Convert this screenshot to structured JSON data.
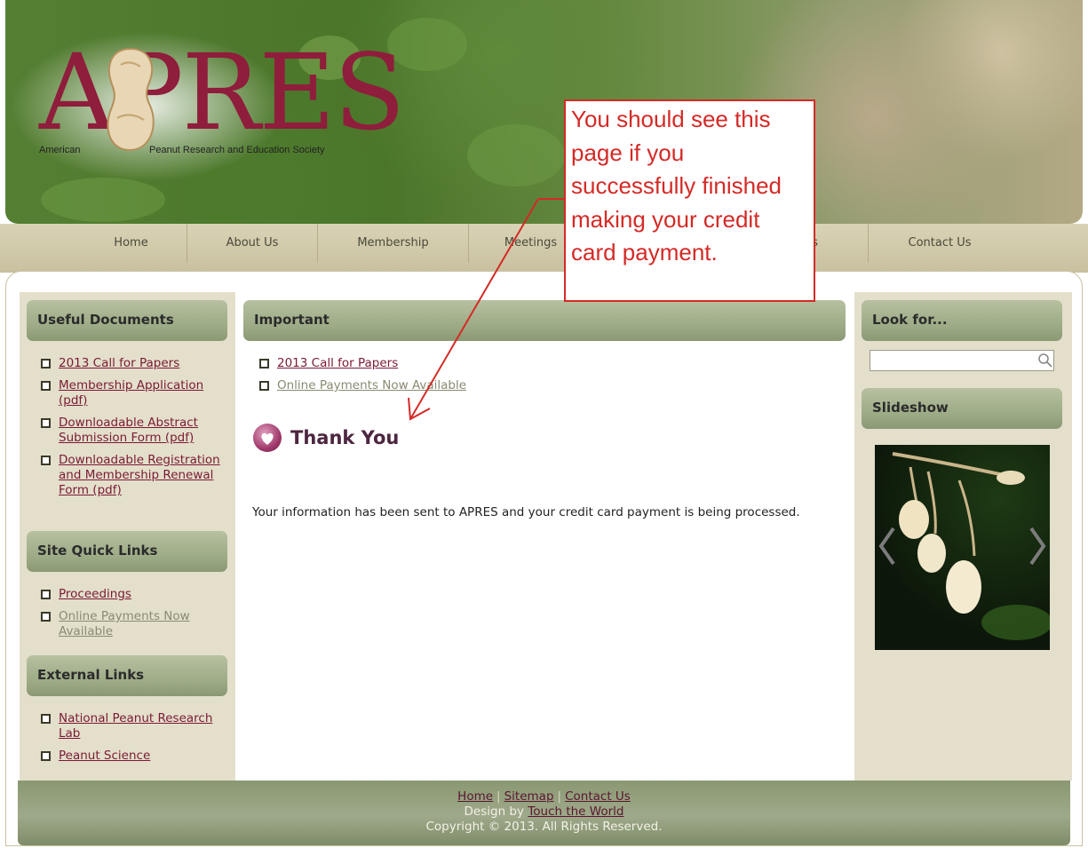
{
  "logo": {
    "wordmark": "APRES",
    "tagline_left": "American",
    "tagline_right": "Peanut Research and Education Society"
  },
  "nav": {
    "items": [
      {
        "label": "Home"
      },
      {
        "label": "About Us"
      },
      {
        "label": "Membership"
      },
      {
        "label": "Meetings"
      },
      {
        "label": "ds"
      },
      {
        "label": "Contact Us"
      }
    ]
  },
  "sidebar": {
    "useful_documents": {
      "title": "Useful Documents",
      "items": [
        "2013 Call for Papers",
        "Membership Application (pdf)",
        "Downloadable Abstract Submission Form (pdf)",
        "Downloadable Registration and Membership Renewal Form (pdf)"
      ]
    },
    "site_quick_links": {
      "title": "Site Quick Links",
      "items": [
        "Proceedings",
        "Online Payments Now Available"
      ]
    },
    "external_links": {
      "title": "External Links",
      "items": [
        "National Peanut Research Lab",
        "Peanut Science"
      ]
    }
  },
  "main": {
    "important_title": "Important",
    "important_links": [
      "2013 Call for Papers",
      "Online Payments Now Available"
    ],
    "heading": "Thank You",
    "message": "Your information has been sent to APRES and your credit card payment is being processed."
  },
  "right": {
    "search_title": "Look for...",
    "search_value": "",
    "slideshow_title": "Slideshow"
  },
  "footer": {
    "links": [
      "Home",
      "Sitemap",
      "Contact Us"
    ],
    "design_prefix": "Design by",
    "designer": "Touch the World",
    "copyright": "Copyright © 2013. All Rights Reserved."
  },
  "annotation": {
    "text": "You should see this page if you successfully finished making your credit card payment.",
    "color": "#d42a26"
  },
  "colors": {
    "brand": "#8f1d3c",
    "link": "#7b1a35",
    "sidebar_bg": "#e3dfcb",
    "header_bar": "#9aa883"
  }
}
